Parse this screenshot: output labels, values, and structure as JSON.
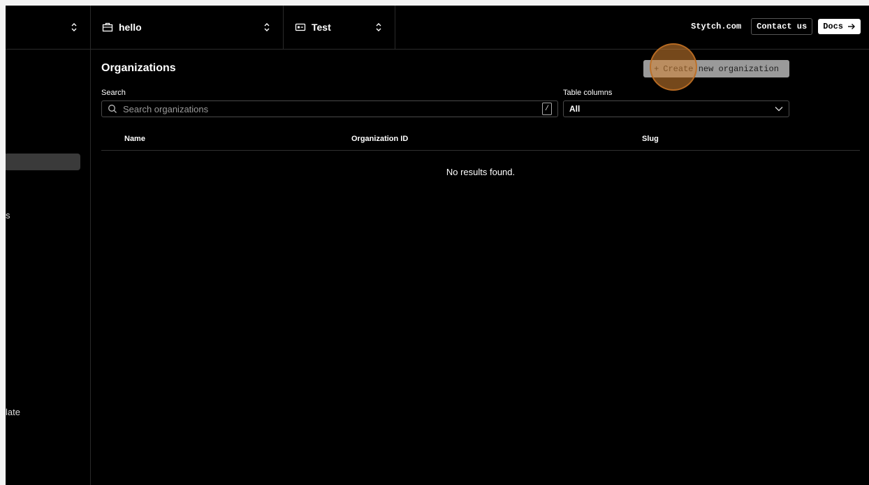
{
  "topbar": {
    "project_name": "hello",
    "environment": "Test",
    "site_link": "Stytch.com",
    "contact_label": "Contact us",
    "docs_label": "Docs"
  },
  "sidebar": {
    "fragment_1": "s",
    "fragment_2": "late"
  },
  "page": {
    "title": "Organizations",
    "create_label": "Create new organization",
    "search_label": "Search",
    "search_placeholder": "Search organizations",
    "search_shortcut": "/",
    "columns_label": "Table columns",
    "columns_value": "All"
  },
  "table": {
    "columns": [
      "Name",
      "Organization ID",
      "Slug"
    ],
    "empty_message": "No results found."
  },
  "colors": {
    "background": "#000000",
    "border": "#2a2a2a",
    "accent_click": "#d68432"
  }
}
